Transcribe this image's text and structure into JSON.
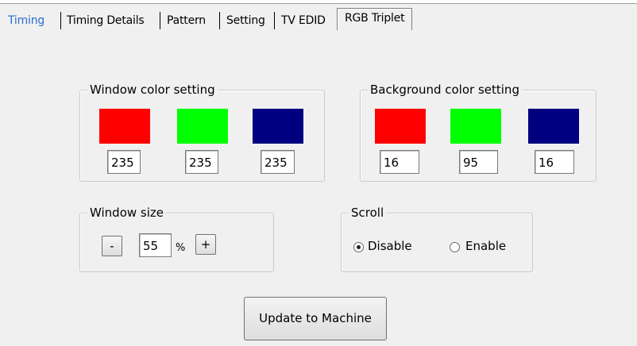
{
  "tabs": [
    {
      "label": "Timing"
    },
    {
      "label": "Timing Details"
    },
    {
      "label": "Pattern"
    },
    {
      "label": "Setting"
    },
    {
      "label": "TV EDID"
    },
    {
      "label": "RGB Triplet"
    }
  ],
  "window_color": {
    "title": "Window color setting",
    "red": "235",
    "green": "235",
    "blue": "235",
    "swatch_colors": [
      "#ff0000",
      "#00ff00",
      "#000080"
    ]
  },
  "background_color": {
    "title": "Background color setting",
    "red": "16",
    "green": "95",
    "blue": "16",
    "swatch_colors": [
      "#ff0000",
      "#00ff00",
      "#000080"
    ]
  },
  "window_size": {
    "title": "Window size",
    "minus_label": "-",
    "value": "55",
    "unit": "%",
    "plus_label": "+"
  },
  "scroll": {
    "title": "Scroll",
    "options": [
      {
        "label": "Disable",
        "selected": true
      },
      {
        "label": "Enable",
        "selected": false
      }
    ]
  },
  "update_button": "Update to Machine"
}
